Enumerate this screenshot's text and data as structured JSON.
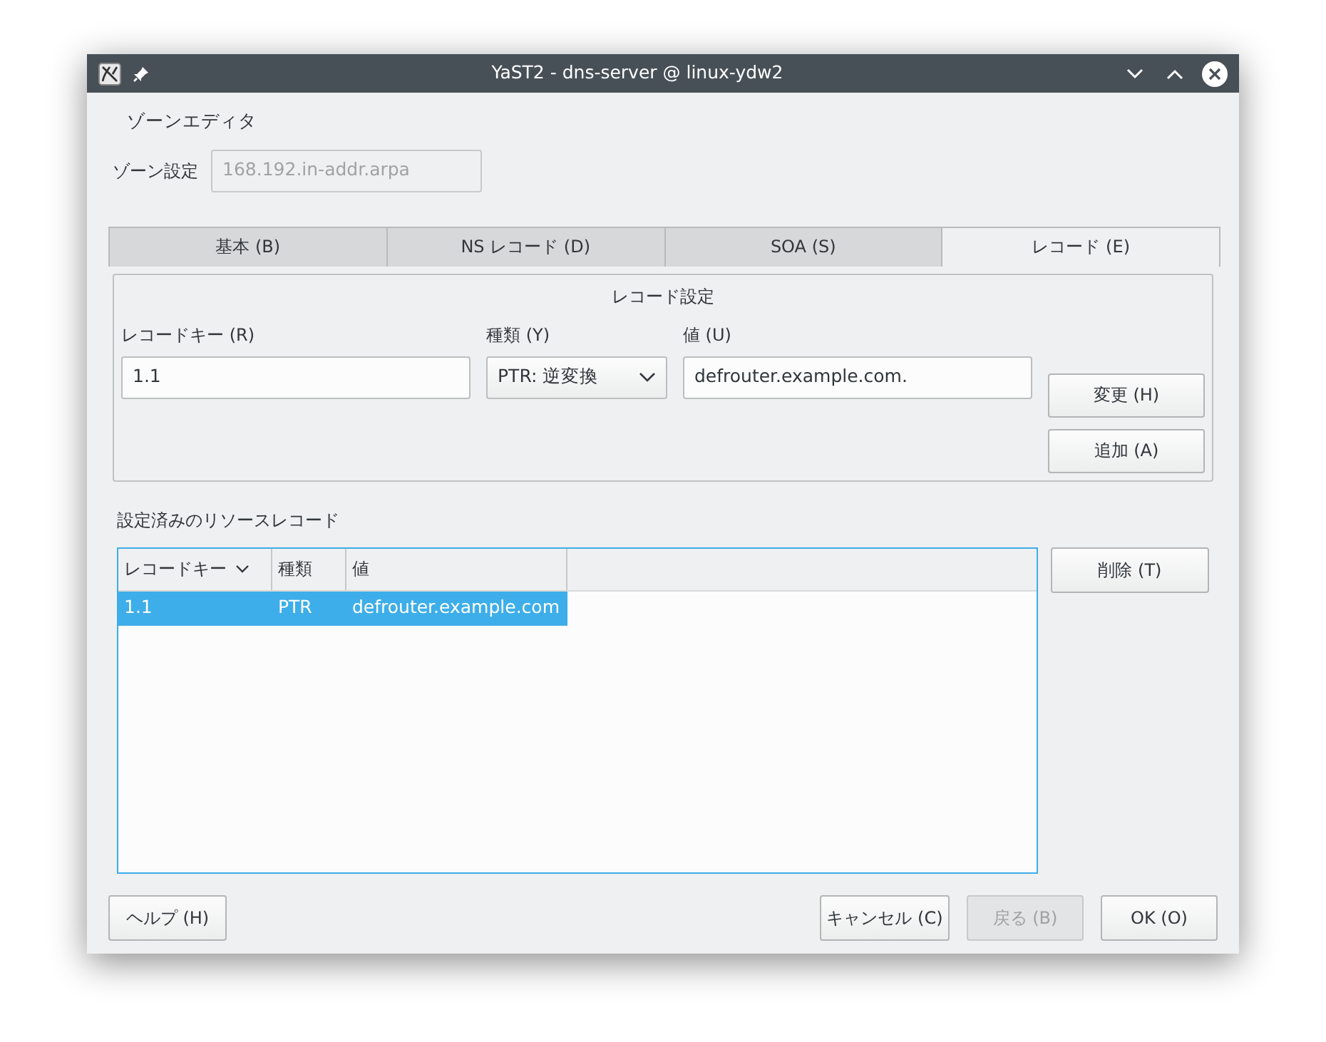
{
  "window": {
    "title": "YaST2 - dns-server @ linux-ydw2"
  },
  "heading": "ゾーンエディタ",
  "zone": {
    "label": "ゾーン設定",
    "value": "168.192.in-addr.arpa",
    "disabled": true
  },
  "tabs": [
    {
      "label": "基本 (B)",
      "selected": false
    },
    {
      "label": "NS レコード (D)",
      "selected": false
    },
    {
      "label": "SOA (S)",
      "selected": false
    },
    {
      "label": "レコード (E)",
      "selected": true
    }
  ],
  "record_group": {
    "title": "レコード設定",
    "key": {
      "label": "レコードキー (R)",
      "value": "1.1"
    },
    "type": {
      "label": "種類 (Y)",
      "value": "PTR: 逆変換"
    },
    "value": {
      "label": "値 (U)",
      "value": "defrouter.example.com."
    },
    "buttons": [
      {
        "label": "変更 (H)"
      },
      {
        "label": "追加 (A)"
      }
    ]
  },
  "records": {
    "label": "設定済みのリソースレコード",
    "columns": [
      {
        "label": "レコードキー",
        "sorted": true
      },
      {
        "label": "種類",
        "sorted": false
      },
      {
        "label": "値",
        "sorted": false
      }
    ],
    "rows": [
      {
        "cells": [
          "1.1",
          "PTR",
          "defrouter.example.com"
        ],
        "selected": true
      }
    ],
    "delete_button": "削除 (T)"
  },
  "footer": [
    {
      "label": "ヘルプ (H)",
      "disabled": false,
      "kind": "left"
    },
    {
      "label": "キャンセル (C)",
      "disabled": false,
      "kind": "right"
    },
    {
      "label": "戻る (B)",
      "disabled": true,
      "kind": "right"
    },
    {
      "label": "OK (O)",
      "disabled": false,
      "kind": "right"
    }
  ]
}
